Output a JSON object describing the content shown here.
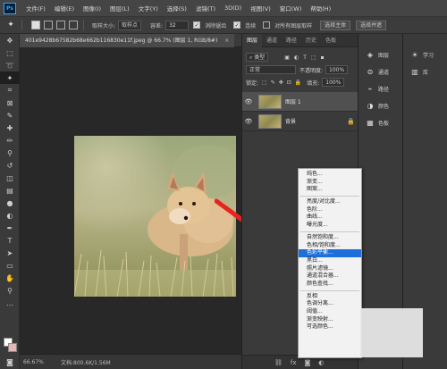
{
  "app": {
    "logo_text": "Ps",
    "menu": [
      "文件(F)",
      "编辑(E)",
      "图像(I)",
      "图层(L)",
      "文字(Y)",
      "选择(S)",
      "滤镜(T)",
      "3D(D)",
      "视图(V)",
      "窗口(W)",
      "帮助(H)"
    ]
  },
  "options_bar": {
    "sample_size_label": "取样大小:",
    "sample_size_value": "取样点",
    "tolerance_label": "容差:",
    "tolerance_value": "32",
    "antialias_label": "消除锯齿",
    "contiguous_label": "连续",
    "all_layers_label": "对所有图层取样",
    "select_subject_label": "选择主体",
    "select_and_mask_label": "选择并遮"
  },
  "document": {
    "tab_title": "401e9428b67582b68e662b116830e11f.jpeg @ 66.7% (图层 1, RGB/8#)",
    "tab_close": "×",
    "zoom": "66.67%",
    "doc_info": "文档:800.6K/1.56M"
  },
  "layers_panel": {
    "tabs": [
      "图层",
      "通道",
      "路径",
      "历史",
      "色板"
    ],
    "filter_value": "类型",
    "blend_mode": "正常",
    "opacity_label": "不透明度:",
    "opacity_value": "100%",
    "lock_label": "锁定:",
    "fill_label": "填充:",
    "fill_value": "100%",
    "layers": [
      {
        "name": "图层 1",
        "selected": true
      },
      {
        "name": "背景",
        "selected": false
      }
    ],
    "footer_icons": [
      "link-icon",
      "fx-icon",
      "mask-icon",
      "adjustment-icon"
    ]
  },
  "dock": {
    "items": [
      "图层",
      "通道",
      "路径",
      "颜色",
      "色板"
    ]
  },
  "dock2": {
    "items": [
      "学习",
      "库"
    ]
  },
  "adjustment_menu": {
    "groups": [
      [
        "纯色...",
        "渐变...",
        "图案..."
      ],
      [
        "亮度/对比度...",
        "色阶...",
        "曲线...",
        "曝光度..."
      ],
      [
        "自然饱和度...",
        "色相/饱和度...",
        "色彩平衡...",
        "黑白...",
        "照片滤镜...",
        "通道混合器...",
        "颜色查找..."
      ],
      [
        "反相",
        "色调分离...",
        "阈值...",
        "渐变映射...",
        "可选颜色..."
      ]
    ],
    "highlighted": "色彩平衡..."
  },
  "colors": {
    "highlight": "#1e6fd9",
    "arrow": "#e8231f",
    "fg_swatch": "#ffffff",
    "bg_swatch": "#e7b7b7"
  }
}
